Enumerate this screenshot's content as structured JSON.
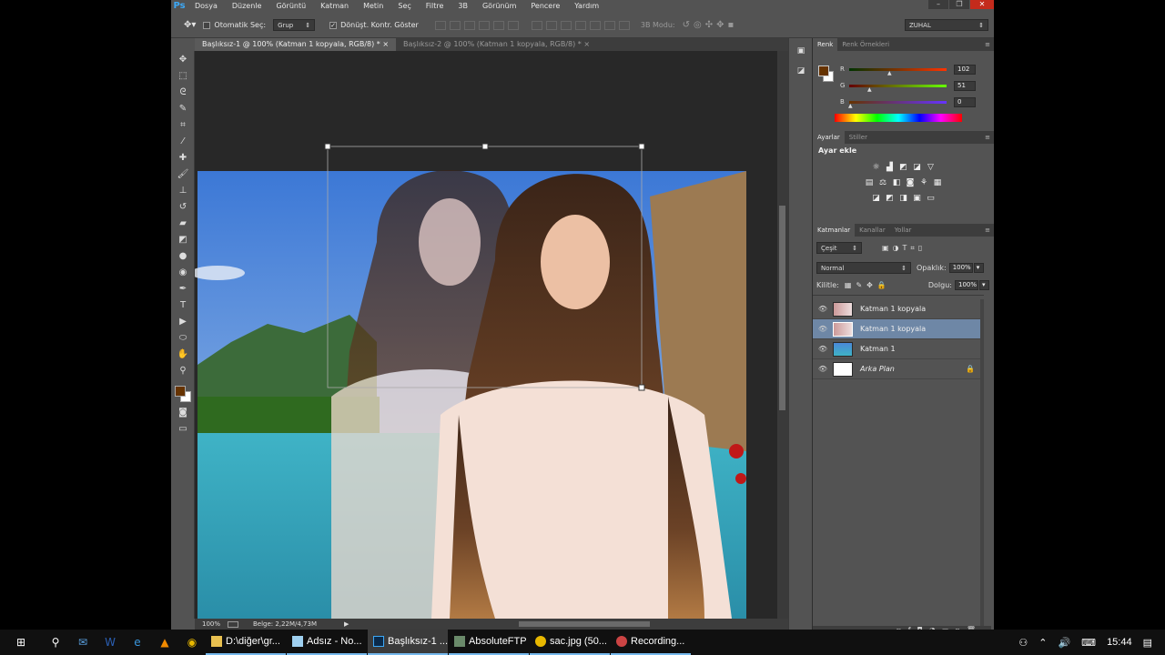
{
  "app": {
    "logo": "Ps"
  },
  "menu": [
    "Dosya",
    "Düzenle",
    "Görüntü",
    "Katman",
    "Metin",
    "Seç",
    "Filtre",
    "3B",
    "Görünüm",
    "Pencere",
    "Yardım"
  ],
  "window_buttons": [
    "–",
    "❐",
    "✕"
  ],
  "options": {
    "auto_select": "Otomatik Seç:",
    "group_value": "Grup",
    "show_transform": "Dönüşt. Kontr. Göster",
    "mode_3d": "3B Modu:",
    "workspace": "ZUHAL"
  },
  "tabs": [
    "Başlıksız-1 @ 100% (Katman 1 kopyala, RGB/8) *",
    "Başlıksız-2 @ 100% (Katman 1 kopyala, RGB/8) *"
  ],
  "tab_close": "×",
  "status": {
    "zoom": "100%",
    "doc_info": "Belge: 2,22M/4,73M"
  },
  "color_panel": {
    "tabs": [
      "Renk",
      "Renk Örnekleri"
    ],
    "foreground": "#663300",
    "background": "#ffffff",
    "r_label": "R",
    "g_label": "G",
    "b_label": "B",
    "r": "102",
    "g": "51",
    "b": "0"
  },
  "adjustments_panel": {
    "tabs": [
      "Ayarlar",
      "Stiller"
    ],
    "title": "Ayar ekle"
  },
  "layers_panel": {
    "tabs": [
      "Katmanlar",
      "Kanallar",
      "Yollar"
    ],
    "filter": "Çeşit",
    "blend_mode": "Normal",
    "opacity_label": "Opaklık:",
    "opacity": "100%",
    "lock_label": "Kilitle:",
    "fill_label": "Dolgu:",
    "fill": "100%",
    "layers": [
      {
        "name": "Katman 1 kopyala",
        "selected": false
      },
      {
        "name": "Katman 1 kopyala",
        "selected": true
      },
      {
        "name": "Katman 1",
        "selected": false
      },
      {
        "name": "Arka Plan",
        "selected": false
      }
    ]
  },
  "taskbar": {
    "apps": [
      "D:\\diğer\\gr...",
      "Adsız - No...",
      "Başlıksız-1 ...",
      "AbsoluteFTP",
      "sac.jpg (50...",
      "Recording..."
    ],
    "clock": "15:44"
  }
}
